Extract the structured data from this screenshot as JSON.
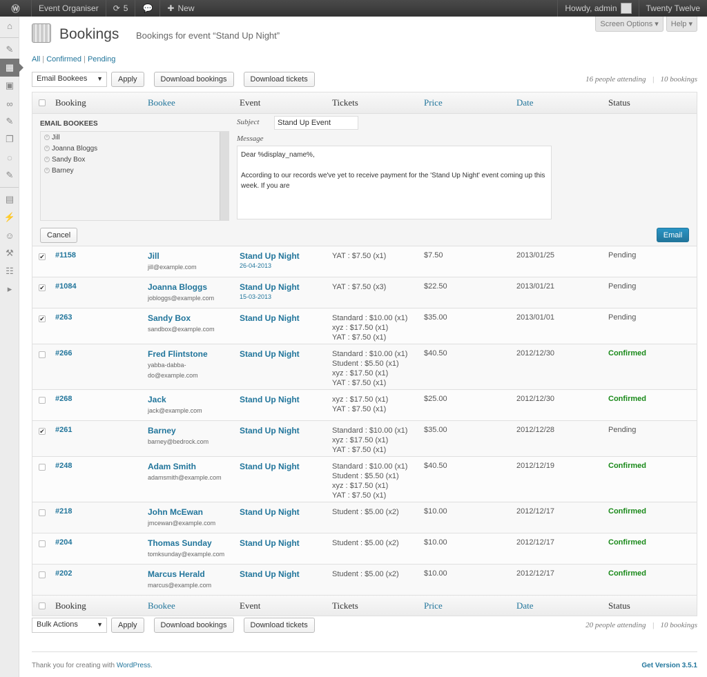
{
  "adminbar": {
    "site": "Event Organiser",
    "updates": "5",
    "new": "New",
    "howdy": "Howdy, admin",
    "theme": "Twenty Twelve"
  },
  "header": {
    "title": "Bookings",
    "subtitle": "Bookings for event “Stand Up Night”",
    "screen_options": "Screen Options ▾",
    "help": "Help ▾"
  },
  "filters": {
    "all": "All",
    "confirmed": "Confirmed",
    "pending": "Pending",
    "sep": "|"
  },
  "topnav": {
    "action": "Email Bookees",
    "apply": "Apply",
    "download_bookings": "Download bookings",
    "download_tickets": "Download tickets",
    "attending": "16 people attending",
    "bookings": "10 bookings",
    "sep": "|"
  },
  "bottomnav": {
    "action": "Bulk Actions",
    "apply": "Apply",
    "download_bookings": "Download bookings",
    "download_tickets": "Download tickets",
    "attending": "20 people attending",
    "bookings": "10 bookings",
    "sep": "|"
  },
  "columns": [
    "Booking",
    "Bookee",
    "Event",
    "Tickets",
    "Price",
    "Date",
    "Status"
  ],
  "sortable_columns": [
    "Bookee",
    "Price",
    "Date"
  ],
  "email_panel": {
    "title": "EMAIL BOOKEES",
    "recipients": [
      "Jill",
      "Joanna Bloggs",
      "Sandy Box",
      "Barney"
    ],
    "subject_label": "Subject",
    "subject": "Stand Up Event",
    "message_label": "Message",
    "message": "Dear %display_name%,\n\nAccording to our records we've yet to receive payment for the 'Stand Up Night' event coming up this week. If you are",
    "cancel": "Cancel",
    "send": "Email"
  },
  "rows": [
    {
      "checked": true,
      "id": "#1158",
      "name": "Jill",
      "email": "jill@example.com",
      "event": "Stand Up Night",
      "event_date": "26-04-2013",
      "tickets": [
        "YAT : $7.50 (x1)"
      ],
      "price": "$7.50",
      "date": "2013/01/25",
      "status": "Pending"
    },
    {
      "checked": true,
      "id": "#1084",
      "name": "Joanna Bloggs",
      "email": "jobloggs@example.com",
      "event": "Stand Up Night",
      "event_date": "15-03-2013",
      "tickets": [
        "YAT : $7.50 (x3)"
      ],
      "price": "$22.50",
      "date": "2013/01/21",
      "status": "Pending"
    },
    {
      "checked": true,
      "id": "#263",
      "name": "Sandy Box",
      "email": "sandbox@example.com",
      "event": "Stand Up Night",
      "tickets": [
        "Standard : $10.00 (x1)",
        "xyz : $17.50 (x1)",
        "YAT : $7.50 (x1)"
      ],
      "price": "$35.00",
      "date": "2013/01/01",
      "status": "Pending"
    },
    {
      "checked": false,
      "id": "#266",
      "name": "Fred Flintstone",
      "email": "yabba-dabba-do@example.com",
      "event": "Stand Up Night",
      "tickets": [
        "Standard : $10.00 (x1)",
        "Student : $5.50 (x1)",
        "xyz : $17.50 (x1)",
        "YAT : $7.50 (x1)"
      ],
      "price": "$40.50",
      "date": "2012/12/30",
      "status": "Confirmed"
    },
    {
      "checked": false,
      "id": "#268",
      "name": "Jack",
      "email": "jack@example.com",
      "event": "Stand Up Night",
      "tickets": [
        "xyz : $17.50 (x1)",
        "YAT : $7.50 (x1)"
      ],
      "price": "$25.00",
      "date": "2012/12/30",
      "status": "Confirmed"
    },
    {
      "checked": true,
      "id": "#261",
      "name": "Barney",
      "email": "barney@bedrock.com",
      "event": "Stand Up Night",
      "tickets": [
        "Standard : $10.00 (x1)",
        "xyz : $17.50 (x1)",
        "YAT : $7.50 (x1)"
      ],
      "price": "$35.00",
      "date": "2012/12/28",
      "status": "Pending"
    },
    {
      "checked": false,
      "id": "#248",
      "name": "Adam Smith",
      "email": "adamsmith@example.com",
      "event": "Stand Up Night",
      "tickets": [
        "Standard : $10.00 (x1)",
        "Student : $5.50 (x1)",
        "xyz : $17.50 (x1)",
        "YAT : $7.50 (x1)"
      ],
      "price": "$40.50",
      "date": "2012/12/19",
      "status": "Confirmed"
    },
    {
      "checked": false,
      "id": "#218",
      "name": "John McEwan",
      "email": "jmcewan@example.com",
      "event": "Stand Up Night",
      "tickets": [
        "Student : $5.00 (x2)"
      ],
      "price": "$10.00",
      "date": "2012/12/17",
      "status": "Confirmed"
    },
    {
      "checked": false,
      "id": "#204",
      "name": "Thomas Sunday",
      "email": "tomksunday@example.com",
      "event": "Stand Up Night",
      "tickets": [
        "Student : $5.00 (x2)"
      ],
      "price": "$10.00",
      "date": "2012/12/17",
      "status": "Confirmed"
    },
    {
      "checked": false,
      "id": "#202",
      "name": "Marcus Herald",
      "email": "marcus@example.com",
      "event": "Stand Up Night",
      "tickets": [
        "Student : $5.00 (x2)"
      ],
      "price": "$10.00",
      "date": "2012/12/17",
      "status": "Confirmed"
    }
  ],
  "footer": {
    "thanks": "Thank you for creating with ",
    "wp": "WordPress",
    "dot": ".",
    "version": "Get Version 3.5.1"
  },
  "colors": {
    "link": "#21759b",
    "confirmed": "#1a8a1a",
    "adminbar": "#464646"
  }
}
